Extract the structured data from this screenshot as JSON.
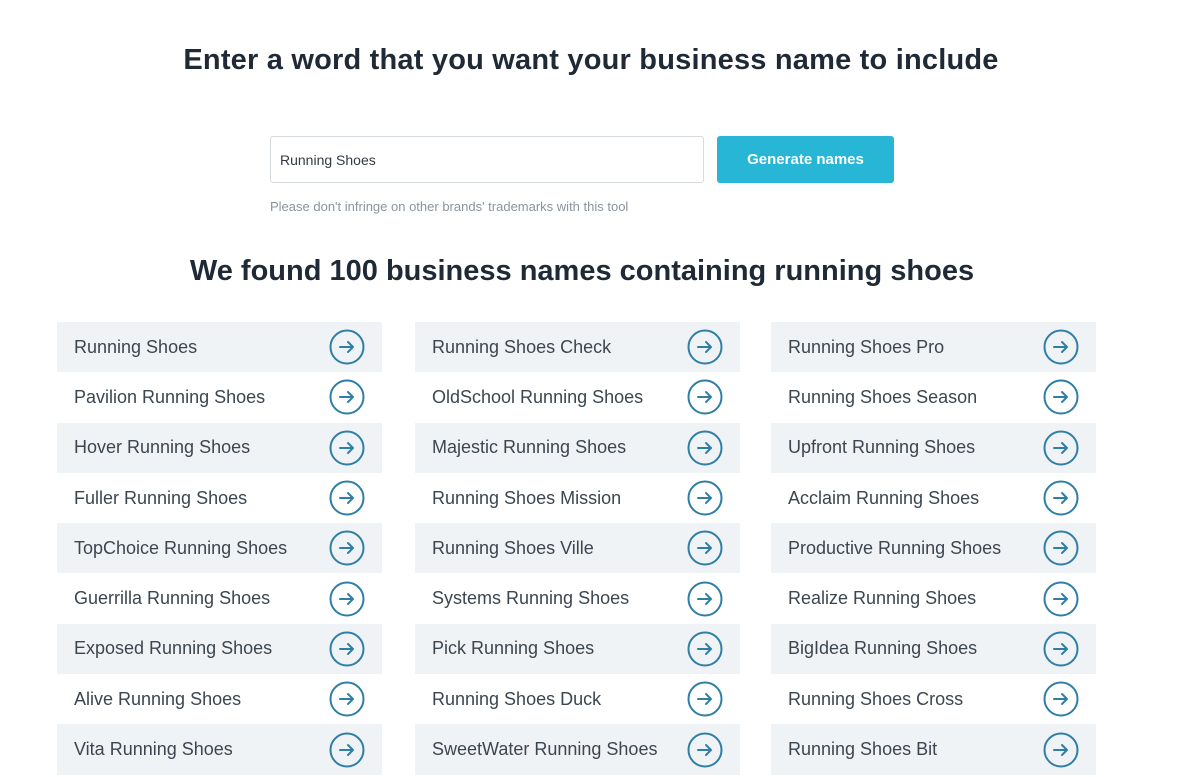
{
  "header": {
    "title": "Enter a word that you want your business name to include"
  },
  "search": {
    "value": "Running Shoes",
    "placeholder": "",
    "button_label": "Generate names",
    "disclaimer": "Please don't infringe on other brands' trademarks with this tool"
  },
  "results": {
    "heading": "We found 100 business names containing running shoes",
    "icon": "arrow-right-circle-icon",
    "columns": [
      {
        "items": [
          "Running Shoes",
          "Pavilion Running Shoes",
          "Hover Running Shoes",
          "Fuller Running Shoes",
          "TopChoice Running Shoes",
          "Guerrilla Running Shoes",
          "Exposed Running Shoes",
          "Alive Running Shoes",
          "Vita Running Shoes"
        ]
      },
      {
        "items": [
          "Running Shoes Check",
          "OldSchool Running Shoes",
          "Majestic Running Shoes",
          "Running Shoes Mission",
          "Running Shoes Ville",
          "Systems Running Shoes",
          "Pick Running Shoes",
          "Running Shoes Duck",
          "SweetWater Running Shoes"
        ]
      },
      {
        "items": [
          "Running Shoes Pro",
          "Running Shoes Season",
          "Upfront Running Shoes",
          "Acclaim Running Shoes",
          "Productive Running Shoes",
          "Realize Running Shoes",
          "BigIdea Running Shoes",
          "Running Shoes Cross",
          "Running Shoes Bit"
        ]
      }
    ]
  },
  "colors": {
    "accent": "#27b6d6",
    "heading": "#1f2a36",
    "row_alt": "#f0f3f6",
    "icon": "#2e7ea6"
  }
}
